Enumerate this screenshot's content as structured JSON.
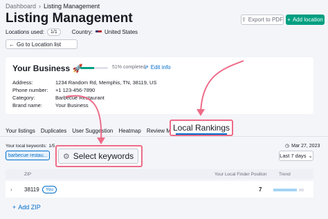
{
  "breadcrumb": {
    "root": "Dashboard",
    "current": "Listing Management"
  },
  "page_title": "Listing Management",
  "meta": {
    "locations_label": "Locations used:",
    "locations_value": "1/1",
    "country_label": "Country:",
    "country_value": "United States"
  },
  "back_button": "Go to Location list",
  "export_button": "Export to PDF",
  "add_location_button": "Add location",
  "business": {
    "name": "Your Business 🚀",
    "progress": {
      "fraction": 0.51,
      "label": "51% completed"
    },
    "edit_label": "Edit info",
    "rows": [
      {
        "k": "Address:",
        "v": "1234 Random Rd, Memphis, TN, 38119, US"
      },
      {
        "k": "Phone number:",
        "v": "+1 123-456-7890"
      },
      {
        "k": "Category:",
        "v": "Barbecue Restaurant"
      },
      {
        "k": "Brand name:",
        "v": "Your Business"
      }
    ]
  },
  "tabs": [
    "Your listings",
    "Duplicates",
    "User Suggestion",
    "Heatmap",
    "Review Managem"
  ],
  "active_tab": "Local Rankings",
  "keywords": {
    "label": "Your local keywords:",
    "count": "1/5",
    "chip": "barbecue restau..."
  },
  "select_keywords": "Select keywords",
  "date": "Mar 27, 2023",
  "range": "Last 7 days",
  "table": {
    "headers": {
      "zip": "ZIP",
      "position": "Your Local Finder Position",
      "trend": "Trend"
    },
    "rows": [
      {
        "zip": "38119",
        "badge": "You",
        "position": "7"
      }
    ]
  },
  "add_zip": "Add ZIP",
  "colors": {
    "accent": "#009f81",
    "link": "#006dca",
    "highlight": "#ee6b88"
  }
}
